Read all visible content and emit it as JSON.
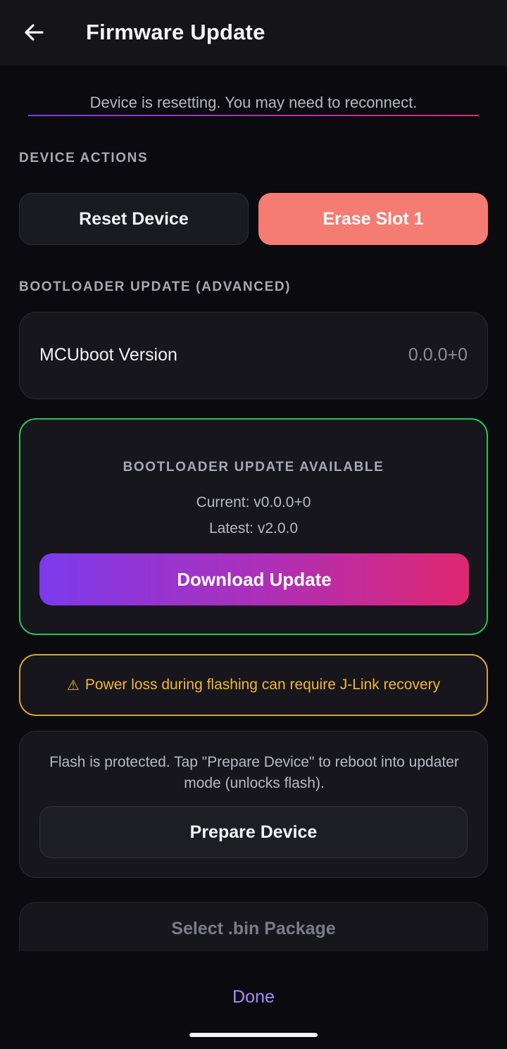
{
  "header": {
    "title": "Firmware Update",
    "back_icon": "arrow-left-icon"
  },
  "status": {
    "message": "Device is resetting. You may need to reconnect."
  },
  "device_actions": {
    "section_label": "DEVICE ACTIONS",
    "reset_label": "Reset Device",
    "erase_label": "Erase Slot 1"
  },
  "bootloader": {
    "section_label": "BOOTLOADER UPDATE (ADVANCED)",
    "mcuboot_label": "MCUboot Version",
    "mcuboot_value": "0.0.0+0",
    "update_title": "BOOTLOADER UPDATE AVAILABLE",
    "current": "Current: v0.0.0+0",
    "latest": "Latest: v2.0.0",
    "download_label": "Download Update"
  },
  "warning": {
    "icon": "⚠",
    "text": "Power loss during flashing can require J-Link recovery"
  },
  "prepare": {
    "text": "Flash is protected. Tap \"Prepare Device\" to reboot into updater mode (unlocks flash).",
    "button_label": "Prepare Device"
  },
  "package": {
    "select_label": "Select .bin Package"
  },
  "footer": {
    "done_label": "Done"
  },
  "colors": {
    "background": "#0b0b0f",
    "erase_accent": "#f47c72",
    "success_border": "#22c55e",
    "warning": "#f5b633",
    "gradient_start": "#7c3aed",
    "gradient_end": "#e0276f",
    "done_link": "#a78bfa"
  }
}
